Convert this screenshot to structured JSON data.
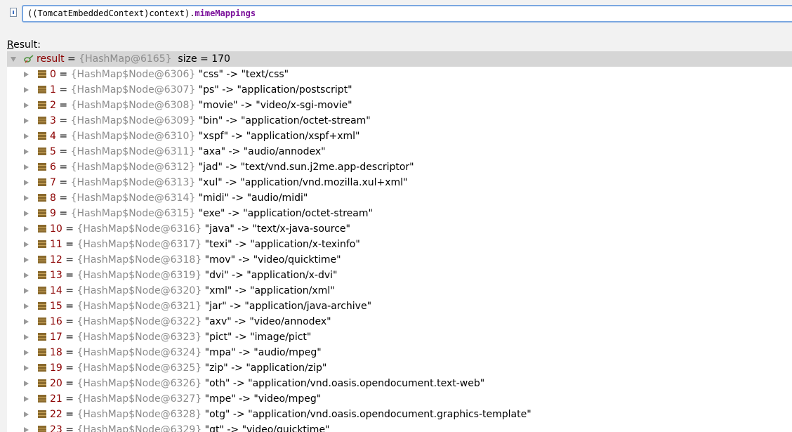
{
  "expression": {
    "prefix": "((TomcatEmbeddedContext)context).",
    "field": "mimeMappings"
  },
  "result_label": {
    "underlined": "R",
    "rest": "esult:"
  },
  "root": {
    "name": "result",
    "equals": " = ",
    "type": "{HashMap@6165}",
    "size": "size = 170"
  },
  "entries": [
    {
      "index": "0",
      "node": "{HashMap$Node@6306}",
      "value": "\"css\" -> \"text/css\""
    },
    {
      "index": "1",
      "node": "{HashMap$Node@6307}",
      "value": "\"ps\" -> \"application/postscript\""
    },
    {
      "index": "2",
      "node": "{HashMap$Node@6308}",
      "value": "\"movie\" -> \"video/x-sgi-movie\""
    },
    {
      "index": "3",
      "node": "{HashMap$Node@6309}",
      "value": "\"bin\" -> \"application/octet-stream\""
    },
    {
      "index": "4",
      "node": "{HashMap$Node@6310}",
      "value": "\"xspf\" -> \"application/xspf+xml\""
    },
    {
      "index": "5",
      "node": "{HashMap$Node@6311}",
      "value": "\"axa\" -> \"audio/annodex\""
    },
    {
      "index": "6",
      "node": "{HashMap$Node@6312}",
      "value": "\"jad\" -> \"text/vnd.sun.j2me.app-descriptor\""
    },
    {
      "index": "7",
      "node": "{HashMap$Node@6313}",
      "value": "\"xul\" -> \"application/vnd.mozilla.xul+xml\""
    },
    {
      "index": "8",
      "node": "{HashMap$Node@6314}",
      "value": "\"midi\" -> \"audio/midi\""
    },
    {
      "index": "9",
      "node": "{HashMap$Node@6315}",
      "value": "\"exe\" -> \"application/octet-stream\""
    },
    {
      "index": "10",
      "node": "{HashMap$Node@6316}",
      "value": "\"java\" -> \"text/x-java-source\""
    },
    {
      "index": "11",
      "node": "{HashMap$Node@6317}",
      "value": "\"texi\" -> \"application/x-texinfo\""
    },
    {
      "index": "12",
      "node": "{HashMap$Node@6318}",
      "value": "\"mov\" -> \"video/quicktime\""
    },
    {
      "index": "13",
      "node": "{HashMap$Node@6319}",
      "value": "\"dvi\" -> \"application/x-dvi\""
    },
    {
      "index": "14",
      "node": "{HashMap$Node@6320}",
      "value": "\"xml\" -> \"application/xml\""
    },
    {
      "index": "15",
      "node": "{HashMap$Node@6321}",
      "value": "\"jar\" -> \"application/java-archive\""
    },
    {
      "index": "16",
      "node": "{HashMap$Node@6322}",
      "value": "\"axv\" -> \"video/annodex\""
    },
    {
      "index": "17",
      "node": "{HashMap$Node@6323}",
      "value": "\"pict\" -> \"image/pict\""
    },
    {
      "index": "18",
      "node": "{HashMap$Node@6324}",
      "value": "\"mpa\" -> \"audio/mpeg\""
    },
    {
      "index": "19",
      "node": "{HashMap$Node@6325}",
      "value": "\"zip\" -> \"application/zip\""
    },
    {
      "index": "20",
      "node": "{HashMap$Node@6326}",
      "value": "\"oth\" -> \"application/vnd.oasis.opendocument.text-web\""
    },
    {
      "index": "21",
      "node": "{HashMap$Node@6327}",
      "value": "\"mpe\" -> \"video/mpeg\""
    },
    {
      "index": "22",
      "node": "{HashMap$Node@6328}",
      "value": "\"otg\" -> \"application/vnd.oasis.opendocument.graphics-template\""
    },
    {
      "index": "23",
      "node": "{HashMap$Node@6329}",
      "value": "\"qt\" -> \"video/quicktime\""
    }
  ],
  "colors": {
    "variable_name": "#8b0000",
    "type_info": "#8c8c8c",
    "field_highlight": "#7a0f9a",
    "root_row_bg": "#d6d6d6",
    "input_border": "#7aa7e0"
  },
  "icons": {
    "expression": "expression-icon",
    "root": "watch-result-icon",
    "entry": "map-entry-icon",
    "expand": "chevron-right-icon",
    "collapse": "chevron-down-icon"
  }
}
